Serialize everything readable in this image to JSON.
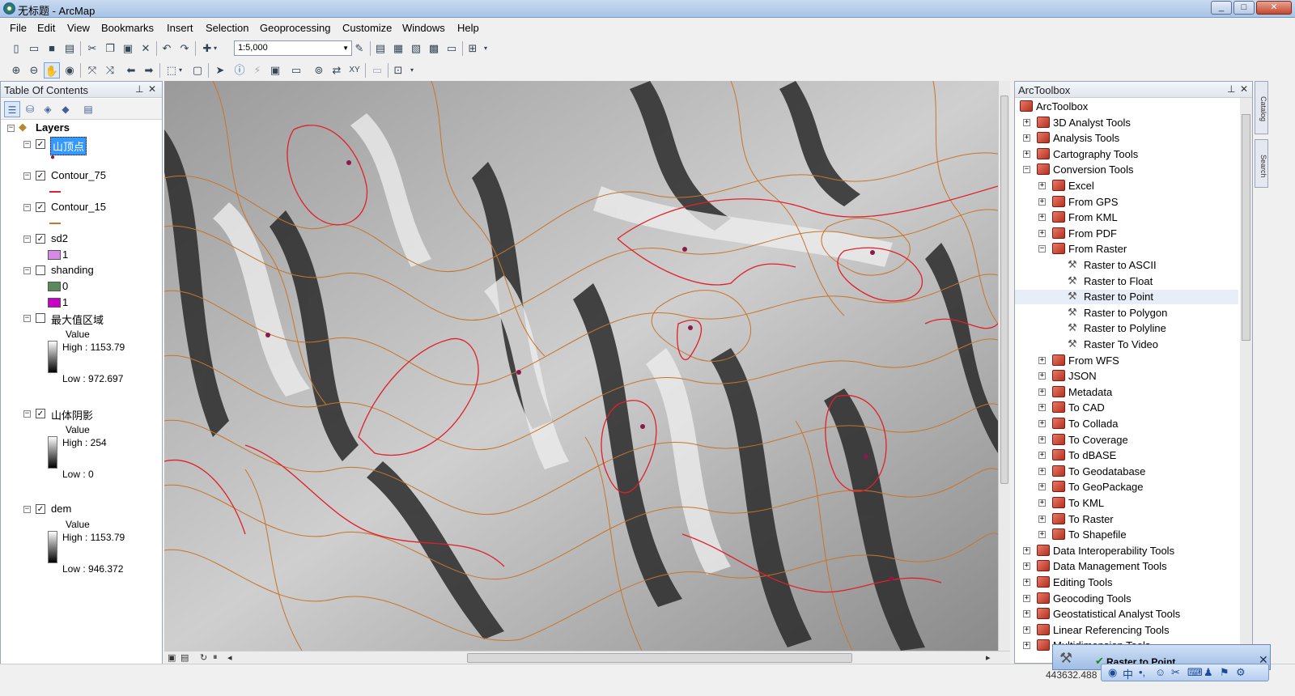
{
  "window": {
    "title": "无标题 - ArcMap",
    "min": "_",
    "max": "□",
    "close": "✕"
  },
  "menu": [
    "File",
    "Edit",
    "View",
    "Bookmarks",
    "Insert",
    "Selection",
    "Geoprocessing",
    "Customize",
    "Windows",
    "Help"
  ],
  "toolbar": {
    "scale": "1:5,000"
  },
  "toc": {
    "title": "Table Of Contents",
    "pin": "⊥",
    "close": "✕",
    "root_label": "Layers",
    "layers": [
      {
        "name": "山顶点",
        "checked": true,
        "symbol": "point",
        "color": "#8b1a4a"
      },
      {
        "name": "Contour_75",
        "checked": true,
        "symbol": "line",
        "color": "#e0202a"
      },
      {
        "name": "Contour_15",
        "checked": true,
        "symbol": "line",
        "color": "#c8742a"
      },
      {
        "name": "sd2",
        "checked": true,
        "classes": [
          {
            "label": "1",
            "color": "#d48ae6"
          }
        ]
      },
      {
        "name": "shanding",
        "checked": false,
        "classes": [
          {
            "label": "0",
            "color": "#5a8a5a"
          },
          {
            "label": "1",
            "color": "#c800c8"
          }
        ]
      },
      {
        "name": "最大值区域",
        "checked": false,
        "ramp": {
          "title": "Value",
          "high": "High : 1153.79",
          "low": "Low : 972.697"
        }
      },
      {
        "name": "山体阴影",
        "checked": true,
        "ramp": {
          "title": "Value",
          "high": "High : 254",
          "low": "Low : 0"
        }
      },
      {
        "name": "dem",
        "checked": true,
        "ramp": {
          "title": "Value",
          "high": "High : 1153.79",
          "low": "Low : 946.372"
        }
      }
    ]
  },
  "toolbox": {
    "title": "ArcToolbox",
    "pin": "⊥",
    "close": "✕",
    "items": [
      {
        "label": "ArcToolbox",
        "level": 0,
        "exp": "",
        "icon": "box"
      },
      {
        "label": "3D Analyst Tools",
        "level": 1,
        "exp": "+",
        "icon": "box"
      },
      {
        "label": "Analysis Tools",
        "level": 1,
        "exp": "+",
        "icon": "box"
      },
      {
        "label": "Cartography Tools",
        "level": 1,
        "exp": "+",
        "icon": "box"
      },
      {
        "label": "Conversion Tools",
        "level": 1,
        "exp": "−",
        "icon": "box"
      },
      {
        "label": "Excel",
        "level": 2,
        "exp": "+",
        "icon": "box"
      },
      {
        "label": "From GPS",
        "level": 2,
        "exp": "+",
        "icon": "box"
      },
      {
        "label": "From KML",
        "level": 2,
        "exp": "+",
        "icon": "box"
      },
      {
        "label": "From PDF",
        "level": 2,
        "exp": "+",
        "icon": "box"
      },
      {
        "label": "From Raster",
        "level": 2,
        "exp": "−",
        "icon": "box"
      },
      {
        "label": "Raster to ASCII",
        "level": 3,
        "exp": "",
        "icon": "hammer"
      },
      {
        "label": "Raster to Float",
        "level": 3,
        "exp": "",
        "icon": "hammer"
      },
      {
        "label": "Raster to Point",
        "level": 3,
        "exp": "",
        "icon": "hammer"
      },
      {
        "label": "Raster to Polygon",
        "level": 3,
        "exp": "",
        "icon": "hammer"
      },
      {
        "label": "Raster to Polyline",
        "level": 3,
        "exp": "",
        "icon": "hammer"
      },
      {
        "label": "Raster To Video",
        "level": 3,
        "exp": "",
        "icon": "hammer"
      },
      {
        "label": "From WFS",
        "level": 2,
        "exp": "+",
        "icon": "box"
      },
      {
        "label": "JSON",
        "level": 2,
        "exp": "+",
        "icon": "box"
      },
      {
        "label": "Metadata",
        "level": 2,
        "exp": "+",
        "icon": "box"
      },
      {
        "label": "To CAD",
        "level": 2,
        "exp": "+",
        "icon": "box"
      },
      {
        "label": "To Collada",
        "level": 2,
        "exp": "+",
        "icon": "box"
      },
      {
        "label": "To Coverage",
        "level": 2,
        "exp": "+",
        "icon": "box"
      },
      {
        "label": "To dBASE",
        "level": 2,
        "exp": "+",
        "icon": "box"
      },
      {
        "label": "To Geodatabase",
        "level": 2,
        "exp": "+",
        "icon": "box"
      },
      {
        "label": "To GeoPackage",
        "level": 2,
        "exp": "+",
        "icon": "box"
      },
      {
        "label": "To KML",
        "level": 2,
        "exp": "+",
        "icon": "box"
      },
      {
        "label": "To Raster",
        "level": 2,
        "exp": "+",
        "icon": "box"
      },
      {
        "label": "To Shapefile",
        "level": 2,
        "exp": "+",
        "icon": "box"
      },
      {
        "label": "Data Interoperability Tools",
        "level": 1,
        "exp": "+",
        "icon": "box"
      },
      {
        "label": "Data Management Tools",
        "level": 1,
        "exp": "+",
        "icon": "box"
      },
      {
        "label": "Editing Tools",
        "level": 1,
        "exp": "+",
        "icon": "box"
      },
      {
        "label": "Geocoding Tools",
        "level": 1,
        "exp": "+",
        "icon": "box"
      },
      {
        "label": "Geostatistical Analyst Tools",
        "level": 1,
        "exp": "+",
        "icon": "box"
      },
      {
        "label": "Linear Referencing Tools",
        "level": 1,
        "exp": "+",
        "icon": "box"
      },
      {
        "label": "Multidimension Tools",
        "level": 1,
        "exp": "+",
        "icon": "box"
      }
    ]
  },
  "side_tabs": [
    "Catalog",
    "Search"
  ],
  "status": {
    "coords": "443632.488"
  },
  "progress": {
    "label": "Raster to Point",
    "check": "✔",
    "close": "✕"
  }
}
